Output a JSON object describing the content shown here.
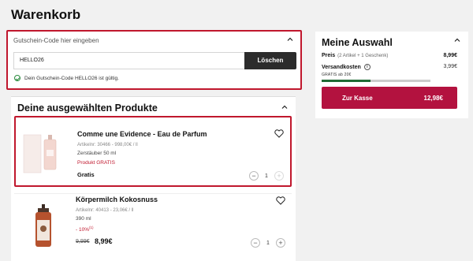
{
  "page_title": "Warenkorb",
  "coupon": {
    "header": "Gutschein-Code hier eingeben",
    "value": "HELLO26",
    "delete_button": "Löschen",
    "valid_message": "Dein Gutschein-Code HELLO26 ist gültig."
  },
  "products": {
    "title": "Deine ausgewählten Produkte",
    "items": [
      {
        "name": "Comme une Evidence - Eau de Parfum",
        "article": "Artikelnr: 30466 - 998,00€ / ll",
        "size": "Zerstäuber 50 ml",
        "promo": "Produkt GRATIS",
        "price": "Gratis",
        "quantity": "1"
      },
      {
        "name": "Körpermilch Kokosnuss",
        "article": "Artikelnr: 40413 - 23,06€ / ll",
        "size": "390 ml",
        "promo": "- 10%",
        "promo_sup": "(1)",
        "old_price": "9,99€",
        "price": "8,99€",
        "quantity": "1"
      }
    ]
  },
  "summary": {
    "title": "Meine Auswahl",
    "price_label": "Preis",
    "price_sub": "(2 Artikel + 1 Geschenk)",
    "price_value": "8,99€",
    "shipping_label": "Versandkosten",
    "shipping_value": "3,99€",
    "free_shipping_note": "GRATIS ab 20€",
    "free_shipping_progress": 0.45,
    "checkout_label": "Zur Kasse",
    "checkout_total": "12,98€"
  },
  "colors": {
    "accent": "#b3123f",
    "highlight": "#c0172d",
    "progress": "#1f6b35"
  }
}
